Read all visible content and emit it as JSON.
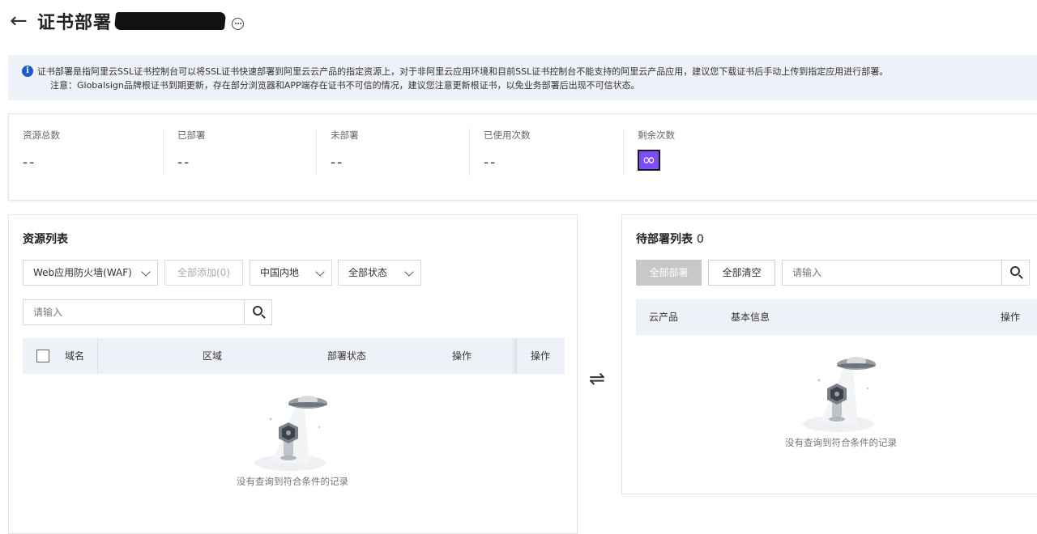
{
  "header": {
    "back_icon": "arrow-left-icon",
    "title": "证书部署",
    "more_icon": "more-circle-icon"
  },
  "notice": {
    "icon": "info-circle-icon",
    "line1": "证书部署是指阿里云SSL证书控制台可以将SSL证书快速部署到阿里云云产品的指定资源上，对于非阿里云应用环境和目前SSL证书控制台不能支持的阿里云产品应用，建议您下载证书后手动上传到指定应用进行部署。",
    "line2": "注意：Globalsign品牌根证书到期更新，存在部分浏览器和APP端存在证书不可信的情况，建议您注意更新根证书，以免业务部署后出现不可信状态。"
  },
  "stats": [
    {
      "label": "资源总数",
      "value": "--"
    },
    {
      "label": "已部署",
      "value": "--"
    },
    {
      "label": "未部署",
      "value": "--"
    },
    {
      "label": "已使用次数",
      "value": "--"
    },
    {
      "label": "剩余次数",
      "value": "∞"
    }
  ],
  "resource_list": {
    "title": "资源列表",
    "product_select": "Web应用防火墙(WAF)",
    "add_all_label": "全部添加(0)",
    "region_select": "中国内地",
    "status_select": "全部状态",
    "search_placeholder": "请输入",
    "columns": [
      "域名",
      "区域",
      "部署状态",
      "操作",
      "操作"
    ],
    "empty_text": "没有查询到符合条件的记录"
  },
  "pending_list": {
    "title": "待部署列表",
    "count": "0",
    "deploy_all_label": "全部部署",
    "clear_all_label": "全部清空",
    "search_placeholder": "请输入",
    "columns": [
      "云产品",
      "基本信息",
      "操作"
    ],
    "empty_text": "没有查询到符合条件的记录"
  },
  "swap_icon": "swap-arrows-icon",
  "colors": {
    "accent": "#1a5ad8",
    "infinity_badge": "#7c4dff",
    "header_bg": "#eef1f8"
  }
}
